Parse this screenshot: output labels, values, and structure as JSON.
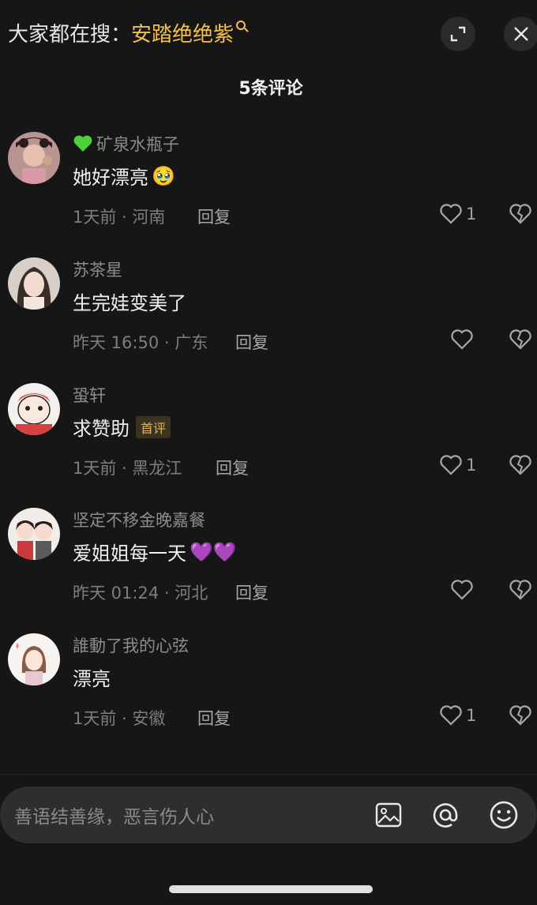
{
  "header": {
    "search_prefix": "大家都在搜：",
    "search_term": "安踏绝绝紫",
    "comment_count_title": "5条评论"
  },
  "comments": [
    {
      "username": "矿泉水瓶子",
      "content": "她好漂亮",
      "emoji": "🥹",
      "meta": "1天前 · 河南",
      "reply_label": "回复",
      "likes": "1"
    },
    {
      "username": "苏茶星",
      "content": "生完娃变美了",
      "meta": "昨天 16:50 · 广东",
      "reply_label": "回复",
      "likes": ""
    },
    {
      "username": "蛩轩",
      "content": "求赞助",
      "tag": "首评",
      "meta": "1天前 · 黑龙江",
      "reply_label": "回复",
      "likes": "1"
    },
    {
      "username": "坚定不移金晚嘉餐",
      "content": "爱姐姐每一天",
      "emoji": "💜💜",
      "meta": "昨天 01:24 · 河北",
      "reply_label": "回复",
      "likes": ""
    },
    {
      "username": "誰動了我的心弦",
      "content": "漂亮",
      "meta": "1天前 · 安徽",
      "reply_label": "回复",
      "likes": "1"
    }
  ],
  "input": {
    "placeholder": "善语结善缘，恶言伤人心"
  },
  "icons": {
    "expand": "expand-icon",
    "close": "close-icon",
    "like": "heart-outline-icon",
    "dislike": "broken-heart-icon",
    "image": "image-icon",
    "mention": "at-sign-icon",
    "emoji": "smiley-icon"
  },
  "colors": {
    "background": "#161616",
    "accent_yellow": "#f2c14e",
    "green_heart": "#4cd137",
    "purple_heart": "#8e44e8"
  }
}
